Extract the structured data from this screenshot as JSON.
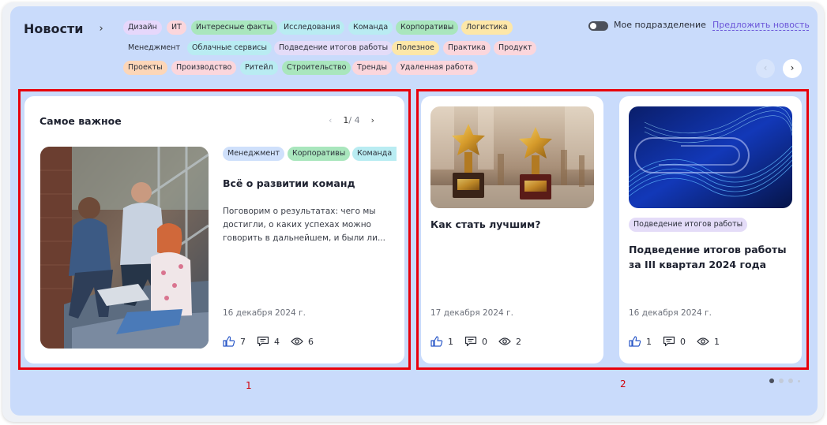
{
  "header": {
    "title": "Новости",
    "toggle_label": "Мое подразделение",
    "suggest_link": "Предложить новость"
  },
  "tags": [
    {
      "label": "Дизайн",
      "color": "purple"
    },
    {
      "label": "ИТ",
      "color": "pink"
    },
    {
      "label": "Интересные факты",
      "color": "green"
    },
    {
      "label": "Исследования",
      "color": "cyan"
    },
    {
      "label": "Команда",
      "color": "cyan"
    },
    {
      "label": "Корпоративы",
      "color": "green"
    },
    {
      "label": "Логистика",
      "color": "yellow"
    },
    {
      "label": "Менеджмент",
      "color": "none"
    },
    {
      "label": "Облачные сервисы",
      "color": "cyan"
    },
    {
      "label": "Подведение итогов работы",
      "color": "lavender"
    },
    {
      "label": "Полезное",
      "color": "yellow"
    },
    {
      "label": "Практика",
      "color": "pink"
    },
    {
      "label": "Продукт",
      "color": "pink"
    },
    {
      "label": "Проекты",
      "color": "orange"
    },
    {
      "label": "Производство",
      "color": "pink"
    },
    {
      "label": "Ритейл",
      "color": "cyan"
    },
    {
      "label": "Строительство",
      "color": "green"
    },
    {
      "label": "Тренды",
      "color": "pink"
    },
    {
      "label": "Удаленная работа",
      "color": "pink"
    }
  ],
  "featured": {
    "section_title": "Самое важное",
    "pager_current": "1",
    "pager_total": "/ 4",
    "tags": [
      "Менеджмент",
      "Корпоративы",
      "Команда"
    ],
    "headline": "Всё о развитии команд",
    "excerpt": "Поговорим о результатах: чего мы достигли, о каких успехах можно говорить в дальнейшем, и были ли...",
    "date": "16 декабря 2024 г.",
    "likes": "7",
    "comments": "4",
    "views": "6"
  },
  "cards": [
    {
      "headline": "Как стать лучшим?",
      "date": "17 декабря 2024 г.",
      "likes": "1",
      "comments": "0",
      "views": "2"
    },
    {
      "tag": "Подведение итогов работы",
      "headline": "Подведение итогов работы за III квартал 2024 года",
      "date": "16 декабря 2024 г.",
      "likes": "1",
      "comments": "0",
      "views": "1"
    }
  ],
  "annotations": [
    "1",
    "2"
  ],
  "colors": {
    "panel": "#c9dbfb",
    "accent_link": "#6a55d8",
    "annotation_red": "#e8000b"
  },
  "icons": [
    "chevron-right-icon",
    "chevron-left-icon",
    "like-icon",
    "comment-icon",
    "eye-icon"
  ]
}
